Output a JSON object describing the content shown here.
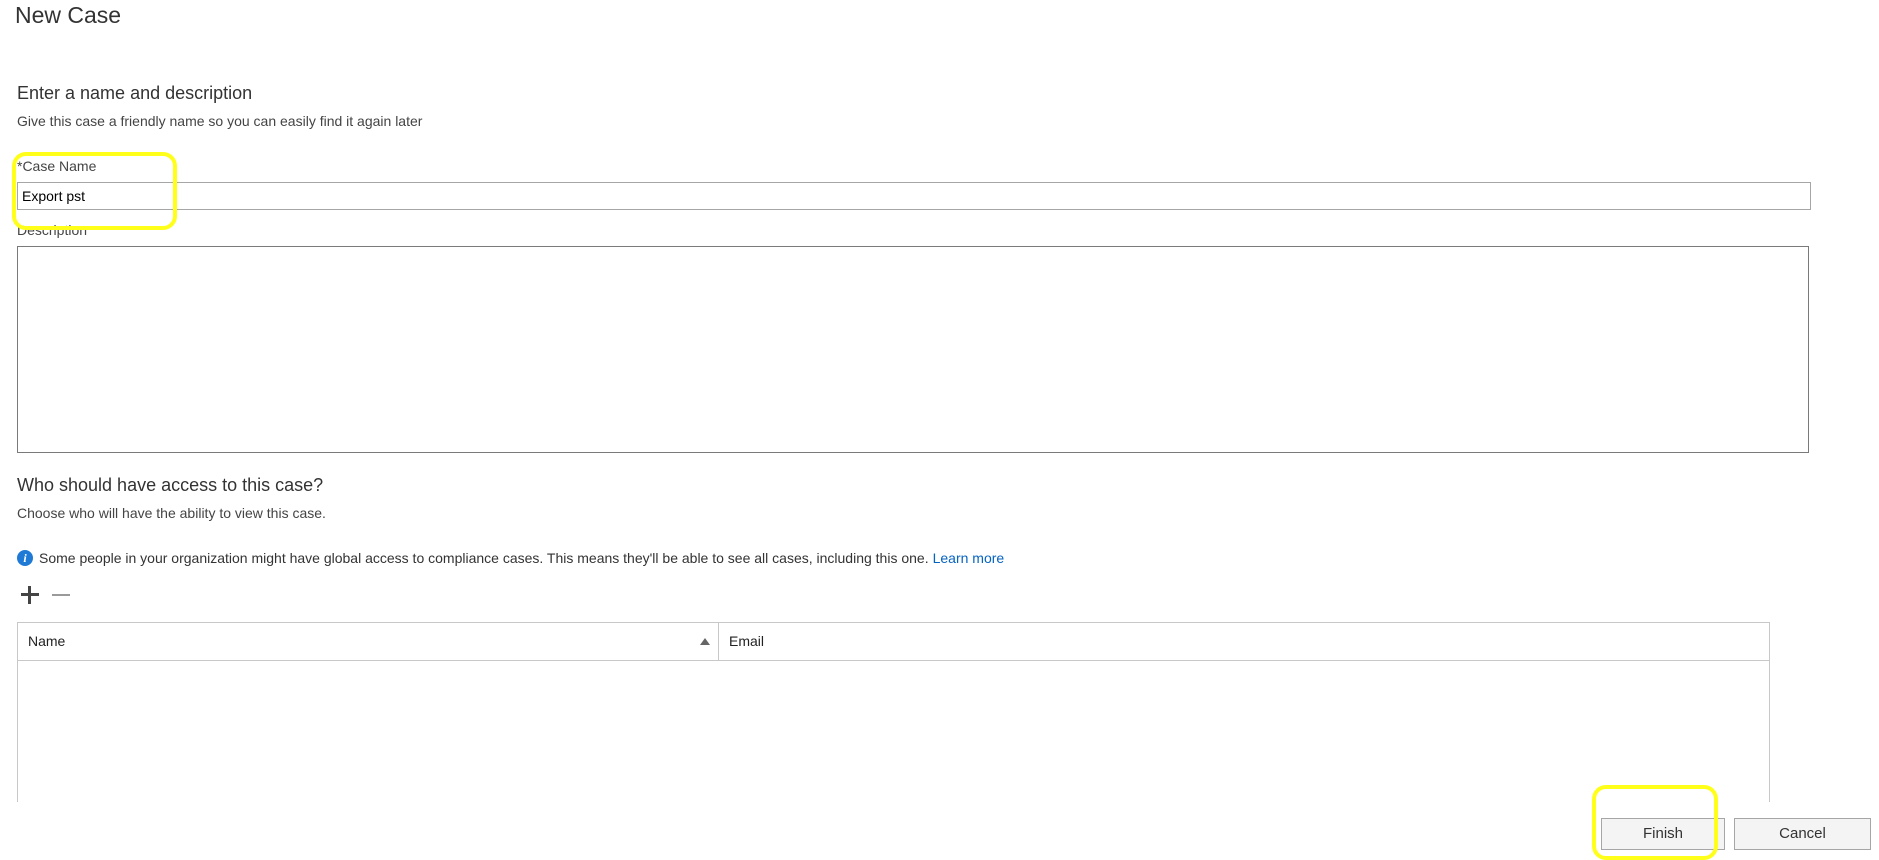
{
  "page": {
    "title": "New Case"
  },
  "name_section": {
    "heading": "Enter a name and description",
    "subtitle": "Give this case a friendly name so you can easily find it again later",
    "case_name_label": "*Case Name",
    "case_name_value": "Export pst",
    "description_label": "Description",
    "description_value": ""
  },
  "access_section": {
    "heading": "Who should have access to this case?",
    "subtitle": "Choose who will have the ability to view this case.",
    "info_text": "Some people in your organization might have global access to compliance cases. This means they'll be able to see all cases, including this one.",
    "learn_more": "Learn more",
    "info_icon_glyph": "i",
    "add_icon": "plus-icon",
    "remove_icon": "minus-icon",
    "columns": [
      "Name",
      "Email"
    ],
    "rows": []
  },
  "footer": {
    "finish_label": "Finish",
    "cancel_label": "Cancel"
  },
  "colors": {
    "highlight": "#ffff1a",
    "link": "#0563c1",
    "info_icon": "#1f7ad6"
  }
}
